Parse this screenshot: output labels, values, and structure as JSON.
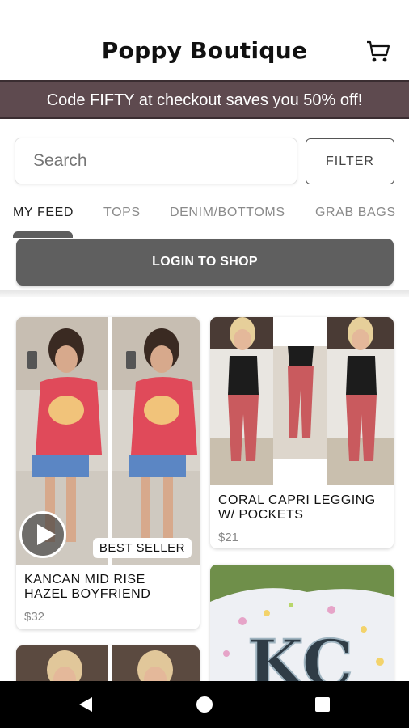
{
  "app": {
    "title": "Poppy Boutique"
  },
  "promo": {
    "text": "Code FIFTY at checkout saves you 50% off!"
  },
  "search": {
    "placeholder": "Search",
    "value": ""
  },
  "filter": {
    "label": "FILTER"
  },
  "tabs": [
    {
      "label": "MY FEED",
      "active": true
    },
    {
      "label": "TOPS",
      "active": false
    },
    {
      "label": "DENIM/BOTTOMS",
      "active": false
    },
    {
      "label": "GRAB BAGS",
      "active": false
    }
  ],
  "login": {
    "label": "LOGIN TO SHOP"
  },
  "products": [
    {
      "name_line1": "KANCAN MID RISE",
      "name_line2": "HAZEL BOYFRIEND",
      "price": "$32",
      "badge": "BEST SELLER",
      "has_video": true,
      "icon": "play-icon"
    },
    {
      "name_line1": "CORAL CAPRI LEGGING",
      "name_line2": "W/ POCKETS",
      "price": "$21"
    }
  ],
  "colors": {
    "promo_bg": "#5e4a4f",
    "login_bg": "#5f5f5f",
    "nav_bg": "#000000"
  },
  "icons": [
    "cart-icon",
    "play-icon",
    "back-icon",
    "home-icon",
    "recents-icon"
  ]
}
